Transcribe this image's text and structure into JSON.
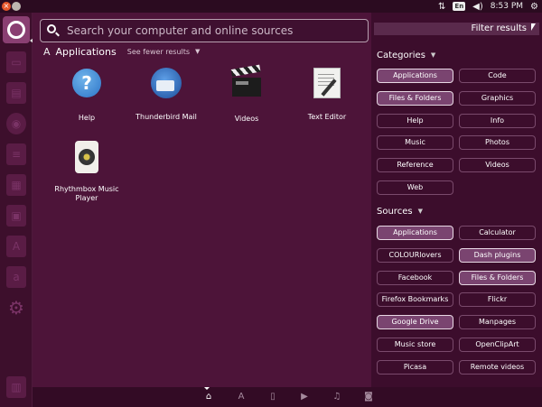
{
  "top_panel": {
    "time": "8:53 PM",
    "keyboard_layout": "En",
    "window_buttons": {
      "close": "×",
      "maximize": ""
    }
  },
  "search": {
    "placeholder": "Search your computer and online sources",
    "value": ""
  },
  "results": {
    "category_title": "Applications",
    "see_fewer_label": "See fewer results",
    "apps": [
      {
        "name": "Help",
        "icon": "help-icon"
      },
      {
        "name": "Thunderbird Mail",
        "icon": "thunderbird-icon"
      },
      {
        "name": "Videos",
        "icon": "videos-icon"
      },
      {
        "name": "Text Editor",
        "icon": "text-editor-icon"
      },
      {
        "name": "Rhythmbox Music Player",
        "icon": "rhythmbox-icon"
      }
    ]
  },
  "filters": {
    "header_label": "Filter results",
    "categories_title": "Categories",
    "categories": [
      {
        "label": "Applications",
        "active": true
      },
      {
        "label": "Code",
        "active": false
      },
      {
        "label": "Files & Folders",
        "active": true
      },
      {
        "label": "Graphics",
        "active": false
      },
      {
        "label": "Help",
        "active": false
      },
      {
        "label": "Info",
        "active": false
      },
      {
        "label": "Music",
        "active": false
      },
      {
        "label": "Photos",
        "active": false
      },
      {
        "label": "Reference",
        "active": false
      },
      {
        "label": "Videos",
        "active": false
      },
      {
        "label": "Web",
        "active": false
      }
    ],
    "sources_title": "Sources",
    "sources": [
      {
        "label": "Applications",
        "active": true
      },
      {
        "label": "Calculator",
        "active": false
      },
      {
        "label": "COLOURlovers",
        "active": false
      },
      {
        "label": "Dash plugins",
        "active": true
      },
      {
        "label": "Facebook",
        "active": false
      },
      {
        "label": "Files & Folders",
        "active": true
      },
      {
        "label": "Firefox Bookmarks",
        "active": false
      },
      {
        "label": "Flickr",
        "active": false
      },
      {
        "label": "Google Drive",
        "active": true
      },
      {
        "label": "Manpages",
        "active": false
      },
      {
        "label": "Music store",
        "active": false
      },
      {
        "label": "OpenClipArt",
        "active": false
      },
      {
        "label": "Picasa",
        "active": false
      },
      {
        "label": "Remote videos",
        "active": false
      }
    ]
  },
  "scope_bar": {
    "icons": [
      "home-icon",
      "applications-icon",
      "files-icon",
      "video-icon",
      "music-icon",
      "photo-icon"
    ],
    "active_index": 0
  },
  "colors": {
    "accent": "#8a3f72",
    "background": "#4d1439"
  }
}
